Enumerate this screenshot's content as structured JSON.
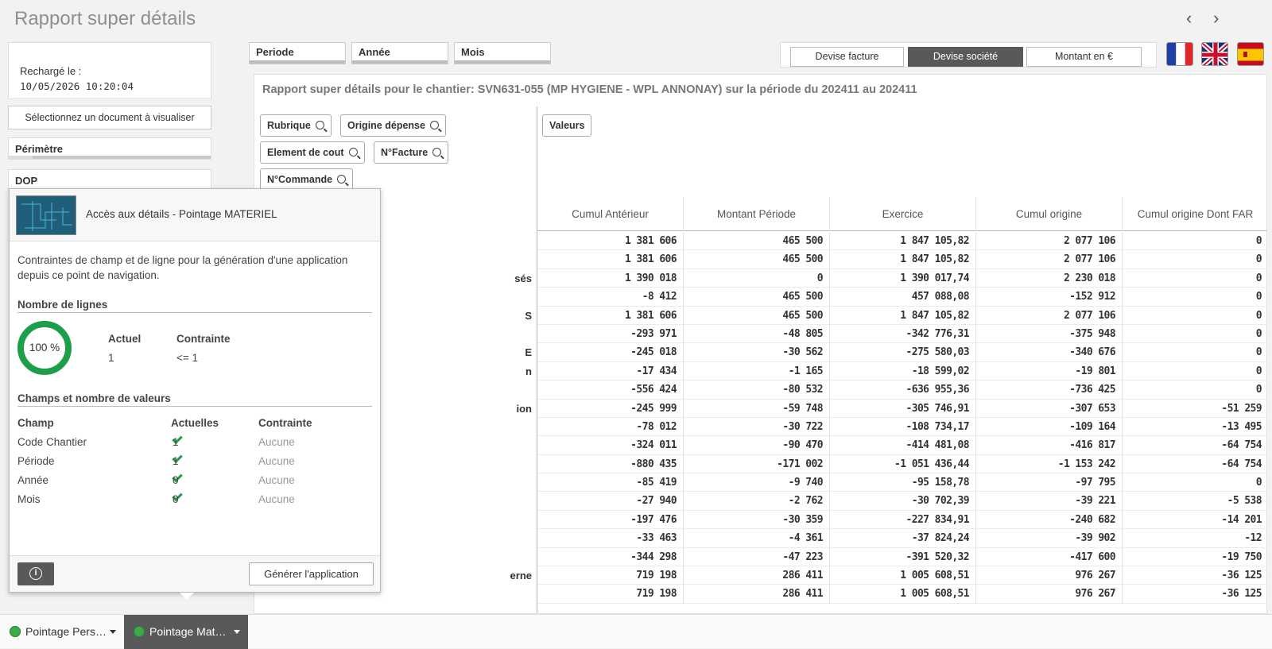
{
  "header": {
    "title": "Rapport super détails"
  },
  "left": {
    "reload_label": "Rechargé le :",
    "reload_date": "10/05/2026 10:20:04",
    "select_doc": "Sélectionnez un document à visualiser",
    "filters": [
      "Périmètre",
      "DOP"
    ]
  },
  "top_filters": [
    "Periode",
    "Année",
    "Mois"
  ],
  "currency": {
    "options": [
      "Devise facture",
      "Devise société",
      "Montant en €"
    ],
    "active": "Devise société"
  },
  "flags": [
    "french-flag",
    "uk-flag",
    "spanish-flag"
  ],
  "report": {
    "title": "Rapport super détails pour le chantier: SVN631-055 (MP HYGIENE - WPL ANNONAY) sur la période du 202411 au 202411",
    "dims": [
      "Rubrique",
      "Origine dépense",
      "Element de cout",
      "N°Facture",
      "N°Commande"
    ],
    "values_btn": "Valeurs",
    "columns": [
      "Cumul Antérieur",
      "Montant Période",
      "Exercice",
      "Cumul origine",
      "Cumul origine Dont FAR"
    ],
    "row_labels": [
      "",
      "",
      "sés",
      "",
      "S",
      "",
      "E",
      "n",
      "",
      "ion",
      "",
      "",
      "",
      "",
      "",
      "",
      "",
      "",
      "erne",
      ""
    ],
    "rows": [
      [
        "1 381 606",
        "465 500",
        "1 847 105,82",
        "2 077 106",
        "0"
      ],
      [
        "1 381 606",
        "465 500",
        "1 847 105,82",
        "2 077 106",
        "0"
      ],
      [
        "1 390 018",
        "0",
        "1 390 017,74",
        "2 230 018",
        "0"
      ],
      [
        "-8 412",
        "465 500",
        "457 088,08",
        "-152 912",
        "0"
      ],
      [
        "1 381 606",
        "465 500",
        "1 847 105,82",
        "2 077 106",
        "0"
      ],
      [
        "-293 971",
        "-48 805",
        "-342 776,31",
        "-375 948",
        "0"
      ],
      [
        "-245 018",
        "-30 562",
        "-275 580,03",
        "-340 676",
        "0"
      ],
      [
        "-17 434",
        "-1 165",
        "-18 599,02",
        "-19 801",
        "0"
      ],
      [
        "-556 424",
        "-80 532",
        "-636 955,36",
        "-736 425",
        "0"
      ],
      [
        "-245 999",
        "-59 748",
        "-305 746,91",
        "-307 653",
        "-51 259"
      ],
      [
        "-78 012",
        "-30 722",
        "-108 734,17",
        "-109 164",
        "-13 495"
      ],
      [
        "-324 011",
        "-90 470",
        "-414 481,08",
        "-416 817",
        "-64 754"
      ],
      [
        "-880 435",
        "-171 002",
        "-1 051 436,44",
        "-1 153 242",
        "-64 754"
      ],
      [
        "-85 419",
        "-9 740",
        "-95 158,78",
        "-97 795",
        "0"
      ],
      [
        "-27 940",
        "-2 762",
        "-30 702,39",
        "-39 221",
        "-5 538"
      ],
      [
        "-197 476",
        "-30 359",
        "-227 834,91",
        "-240 682",
        "-14 201"
      ],
      [
        "-33 463",
        "-4 361",
        "-37 824,24",
        "-39 902",
        "-12"
      ],
      [
        "-344 298",
        "-47 223",
        "-391 520,32",
        "-417 600",
        "-19 750"
      ],
      [
        "719 198",
        "286 411",
        "1 005 608,51",
        "976 267",
        "-36 125"
      ],
      [
        "719 198",
        "286 411",
        "1 005 608,51",
        "976 267",
        "-36 125"
      ]
    ]
  },
  "popup": {
    "title": "Accès aux détails - Pointage MATERIEL",
    "desc": "Contraintes de champ et de ligne pour la génération d'une application depuis ce point de navigation.",
    "lines_section": "Nombre de lignes",
    "donut_pct": "100 %",
    "donut_fraction": 1.0,
    "actuel_h": "Actuel",
    "actuel_v": "1",
    "contrainte_h": "Contrainte",
    "contrainte_v": "<= 1",
    "fields_section": "Champs et nombre de valeurs",
    "fields_head": [
      "Champ",
      "Actuelles",
      "Contrainte"
    ],
    "fields": [
      {
        "name": "Code Chantier",
        "value": "1",
        "constraint": "Aucune"
      },
      {
        "name": "Période",
        "value": "1",
        "constraint": "Aucune"
      },
      {
        "name": "Année",
        "value": "0",
        "constraint": "Aucune"
      },
      {
        "name": "Mois",
        "value": "0",
        "constraint": "Aucune"
      }
    ],
    "generate": "Générer l'application"
  },
  "tabs": [
    {
      "label": "Pointage Pers…",
      "active": false
    },
    {
      "label": "Pointage Mat…",
      "active": true
    }
  ],
  "colors": {
    "accent_green": "#1e9e4a",
    "active_dark": "#595959"
  }
}
